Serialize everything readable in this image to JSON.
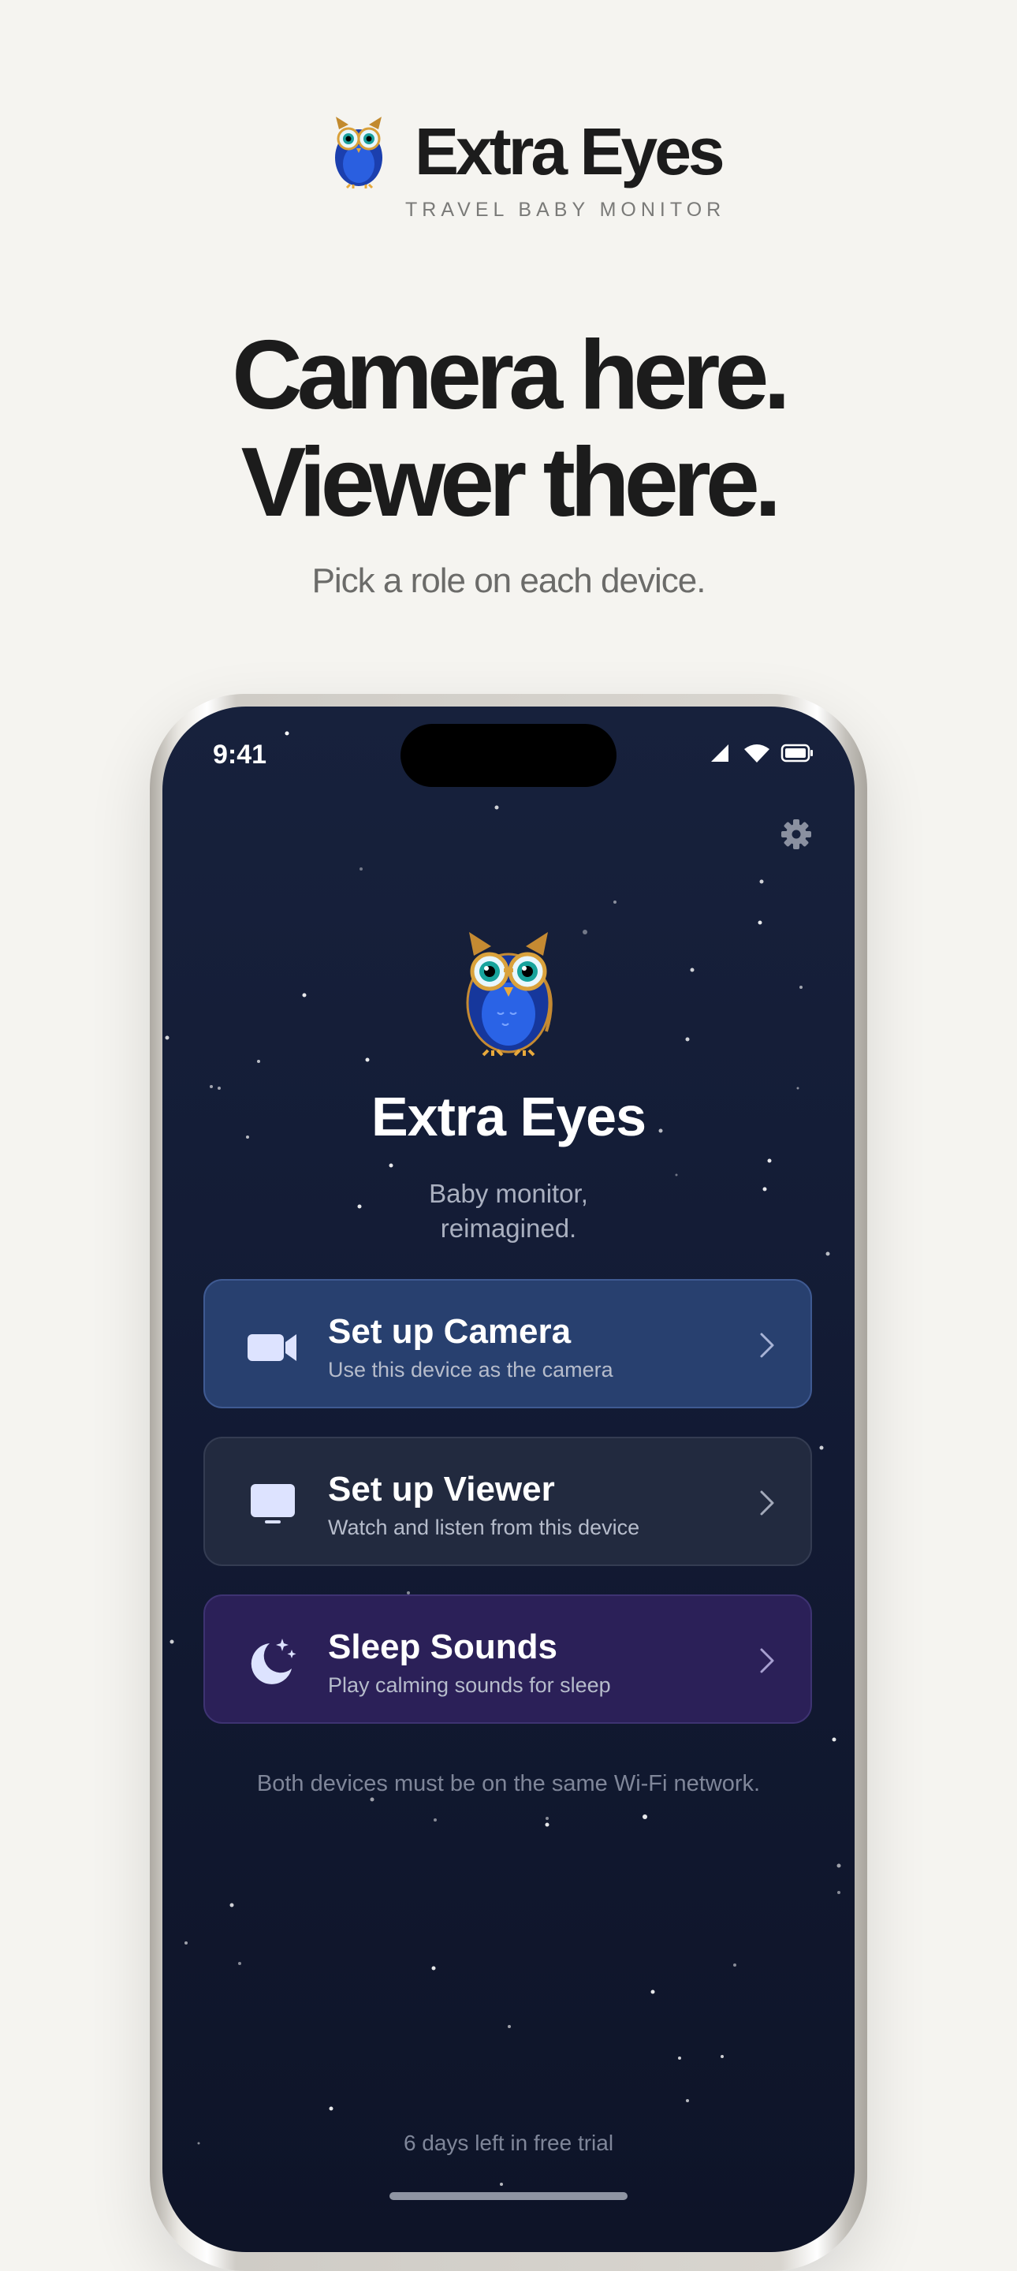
{
  "brand": {
    "name": "Extra Eyes",
    "tagline": "TRAVEL BABY MONITOR",
    "logo_icon": "owl-icon"
  },
  "hero": {
    "line1": "Camera here.",
    "line2": "Viewer there.",
    "subtitle": "Pick a role on each device."
  },
  "phone": {
    "status_bar": {
      "time": "9:41",
      "icons": [
        "signal-icon",
        "wifi-icon",
        "battery-icon"
      ]
    },
    "settings_icon": "gear-icon",
    "app_title": "Extra Eyes",
    "app_subtitle_line1": "Baby monitor,",
    "app_subtitle_line2": "reimagined.",
    "options": [
      {
        "icon": "video-camera-icon",
        "title": "Set up Camera",
        "description": "Use this device as the camera",
        "background": "#28406f"
      },
      {
        "icon": "monitor-icon",
        "title": "Set up Viewer",
        "description": "Watch and listen from this device",
        "background": "#222a3f"
      },
      {
        "icon": "moon-stars-icon",
        "title": "Sleep Sounds",
        "description": "Play calming sounds for sleep",
        "background": "#2b2058"
      }
    ],
    "network_note": "Both devices must be on the same Wi-Fi network.",
    "trial_status": "6 days left in free trial"
  },
  "colors": {
    "page_background": "#f5f4f0",
    "screen_background": "#131b35",
    "accent_icon": "#d9e0ff"
  }
}
